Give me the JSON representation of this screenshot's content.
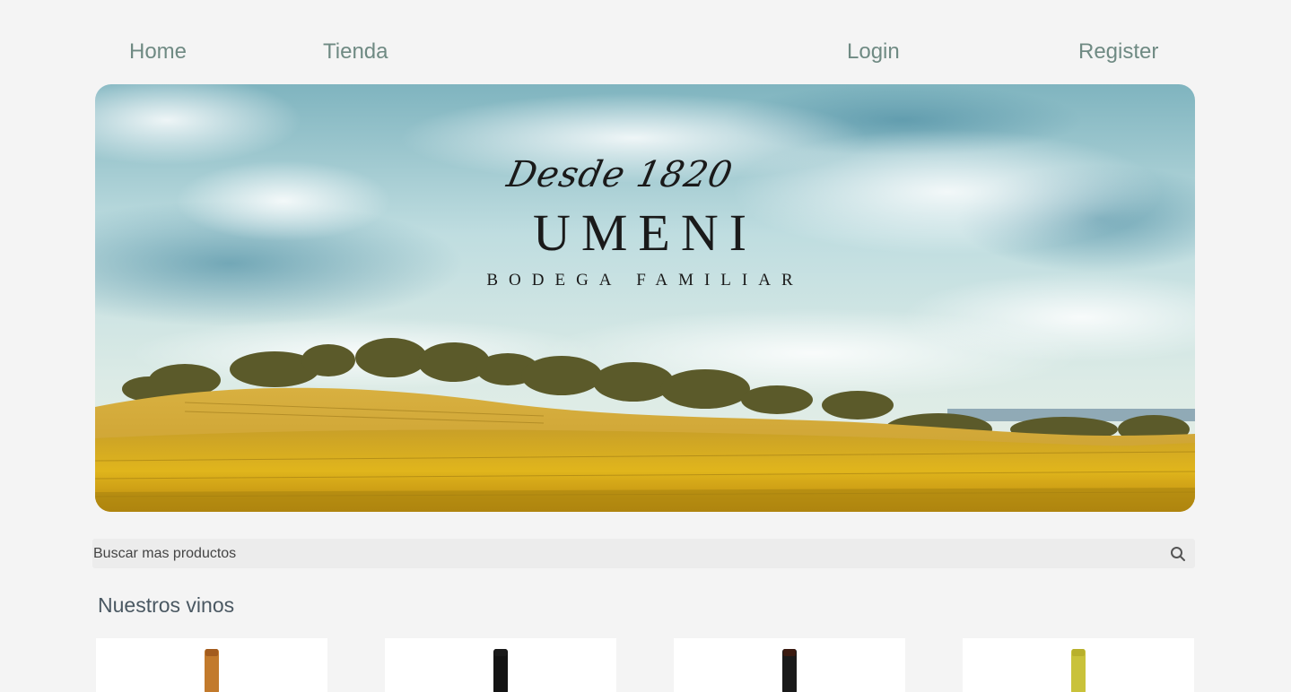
{
  "nav": {
    "home": "Home",
    "tienda": "Tienda",
    "login": "Login",
    "register": "Register"
  },
  "hero": {
    "script": "Desde 1820",
    "brand": "UMENI",
    "subtitle": "BODEGA FAMILIAR"
  },
  "search": {
    "placeholder": "Buscar mas productos",
    "icon": "search-icon"
  },
  "products": {
    "title": "Nuestros vinos",
    "items": [
      {
        "bottle_color": "#c27a2c",
        "cap_color": "#a35c1e"
      },
      {
        "bottle_color": "#141414",
        "cap_color": "#1b1b1b"
      },
      {
        "bottle_color": "#1a1a1a",
        "cap_color": "#3a1a10"
      },
      {
        "bottle_color": "#c9c23a",
        "cap_color": "#b8b02c"
      }
    ]
  },
  "colors": {
    "nav_link": "#6f8a83",
    "background": "#f4f4f4",
    "heading": "#4a5862"
  }
}
